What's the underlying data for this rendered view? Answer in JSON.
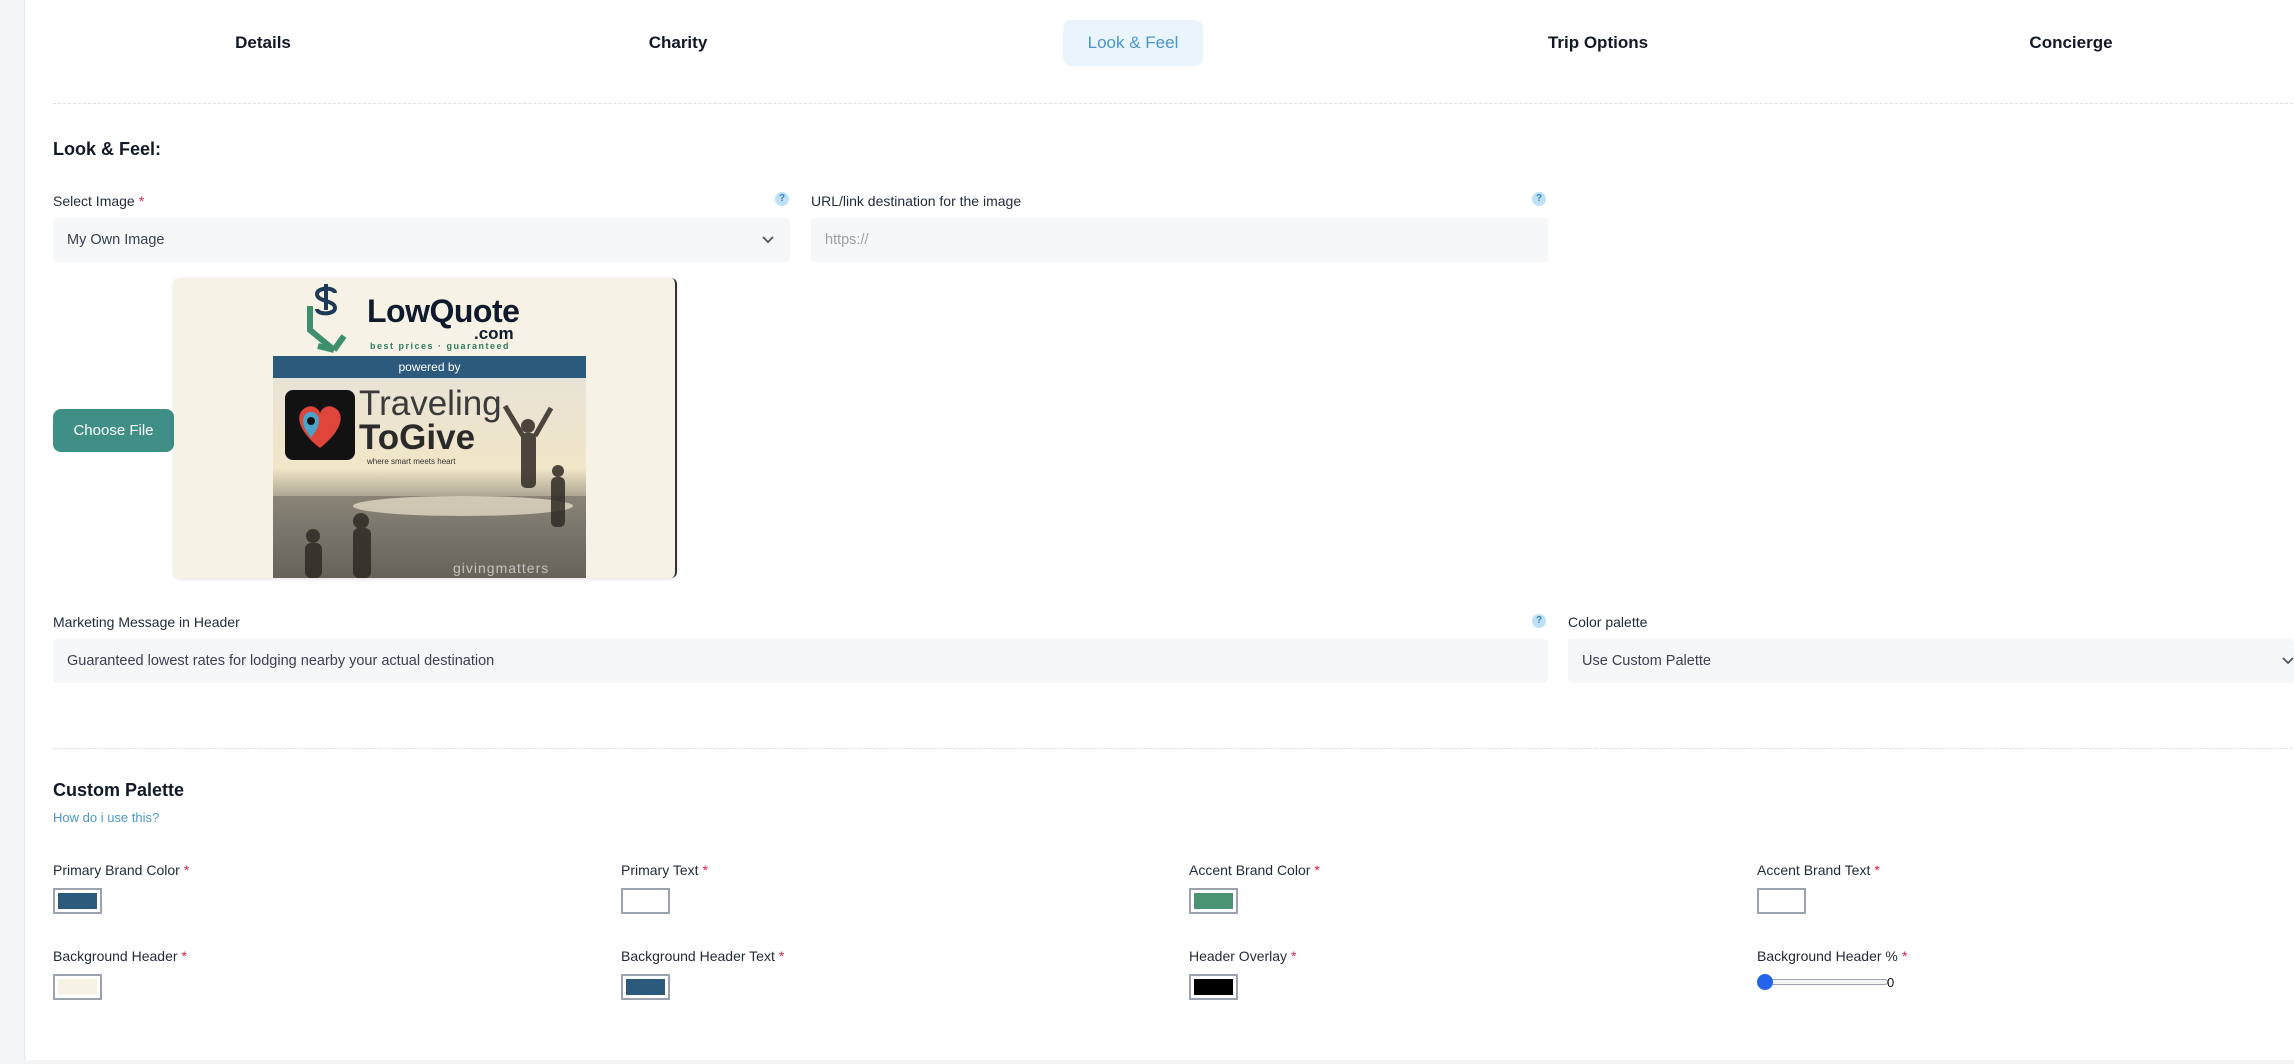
{
  "tabs": [
    {
      "label": "Details"
    },
    {
      "label": "Charity"
    },
    {
      "label": "Look & Feel",
      "active": true
    },
    {
      "label": "Trip Options"
    },
    {
      "label": "Concierge"
    }
  ],
  "look_feel": {
    "heading": "Look & Feel:",
    "select_image": {
      "label": "Select Image",
      "value": "My Own Image"
    },
    "url_link": {
      "label": "URL/link destination for the image",
      "placeholder": "https://"
    },
    "choose_file_label": "Choose File",
    "preview": {
      "brand_name": "LowQuote",
      "brand_domain": ".com",
      "brand_tagline": "best prices · guaranteed",
      "powered_by": "powered by",
      "partner_line1": "Traveling",
      "partner_line2": "ToGive",
      "partner_tagline": "where smart meets heart",
      "watermark": "givingmatters"
    },
    "marketing": {
      "label": "Marketing Message in Header",
      "value": "Guaranteed lowest rates for lodging nearby your actual destination"
    },
    "color_palette": {
      "label": "Color palette",
      "value": "Use Custom Palette"
    }
  },
  "custom_palette": {
    "heading": "Custom Palette",
    "help_link": "How do i use this?",
    "required_marker": "*",
    "fields": [
      {
        "label": "Primary Brand Color",
        "color": "#2b5a7c"
      },
      {
        "label": "Primary Text",
        "color": "#ffffff"
      },
      {
        "label": "Accent Brand Color",
        "color": "#4a9474"
      },
      {
        "label": "Accent Brand Text",
        "color": "#ffffff"
      },
      {
        "label": "Background Header",
        "color": "#f6f2e6"
      },
      {
        "label": "Background Header Text",
        "color": "#2b5a7c"
      },
      {
        "label": "Header Overlay",
        "color": "#000000"
      }
    ],
    "bg_header_percent": {
      "label": "Background Header %",
      "value": "0"
    }
  },
  "help_icon_glyph": "?"
}
